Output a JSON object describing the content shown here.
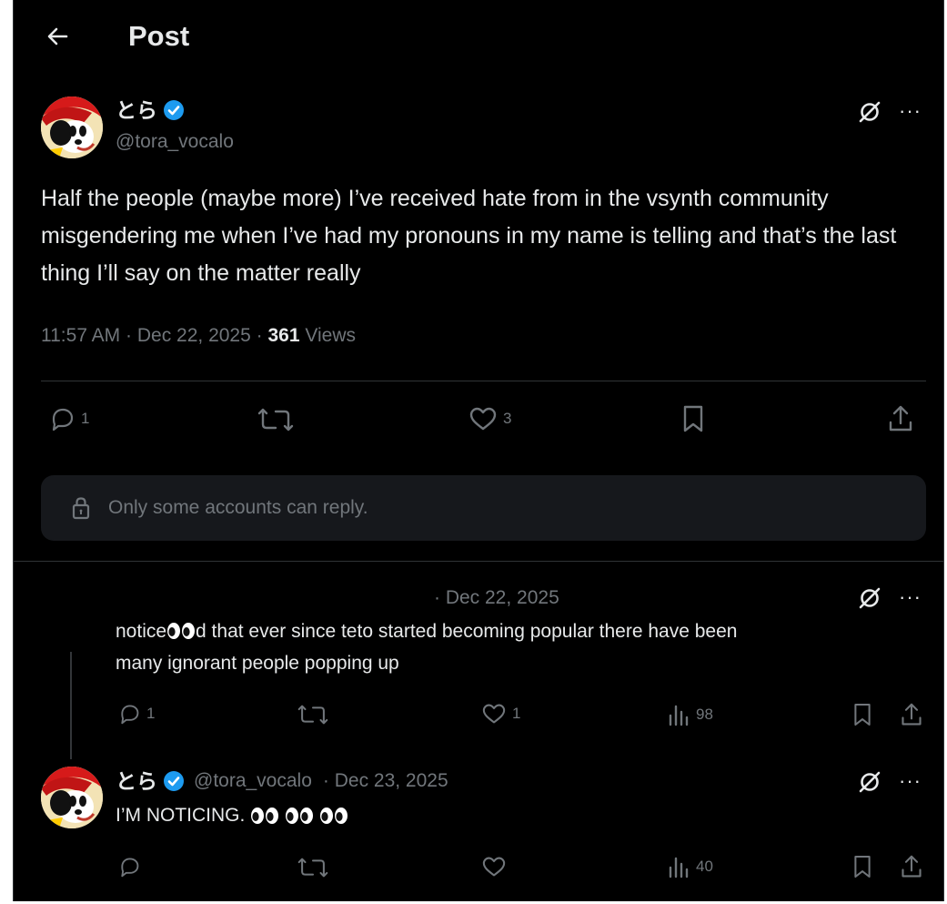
{
  "header": {
    "title": "Post"
  },
  "main_post": {
    "author": {
      "name": "とら",
      "handle": "@tora_vocalo",
      "verified": true
    },
    "text": "Half the people (maybe more) I’ve received hate from in the vsynth community misgendering me when I’ve had my pronouns in my name is telling and that’s the last thing I’ll say on the matter really",
    "time": "11:57 AM",
    "date": "Dec 22, 2025",
    "views_count": "361",
    "views_label": "Views",
    "sep": "·",
    "actions": {
      "replies": "1",
      "likes": "3"
    }
  },
  "reply_restriction": {
    "text": "Only some accounts can reply."
  },
  "replies": [
    {
      "date": "· Dec 22, 2025",
      "text_line1": "notice",
      "text_line1_after": "d that ever since teto started becoming popular there have been",
      "text_line2": "many ignorant people popping up",
      "actions": {
        "replies": "1",
        "likes": "1",
        "views": "98"
      }
    },
    {
      "author": {
        "name": "とら",
        "handle": "@tora_vocalo",
        "verified": true
      },
      "date": "· Dec 23, 2025",
      "text": "I’M NOTICING.",
      "actions": {
        "views": "40"
      }
    }
  ],
  "colors": {
    "background": "#000000",
    "text": "#e7e9ea",
    "muted": "#71767b",
    "verified": "#1d9bf0",
    "divider": "#2f3336"
  },
  "icons": [
    "back-arrow-icon",
    "verified-badge-icon",
    "grok-icon",
    "more-icon",
    "reply-icon",
    "repost-icon",
    "like-icon",
    "bookmark-icon",
    "share-icon",
    "lock-icon",
    "views-icon",
    "eyes-emoji"
  ]
}
